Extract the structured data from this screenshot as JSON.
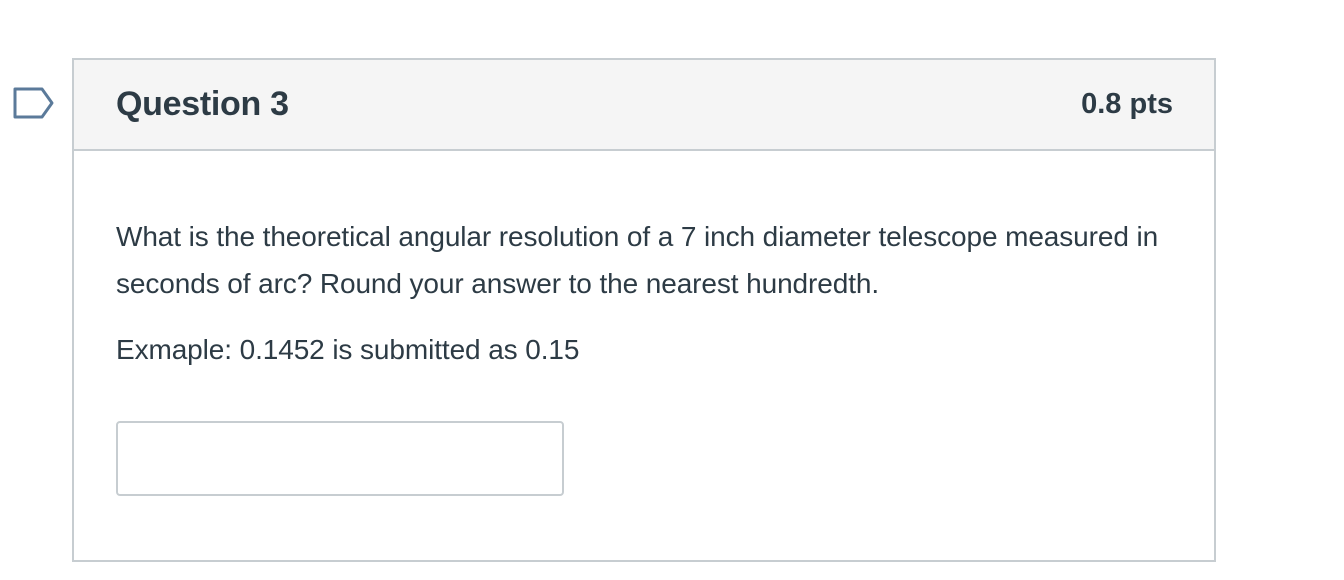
{
  "question": {
    "title": "Question 3",
    "points": "0.8 pts",
    "text": "What is the theoretical angular resolution of a 7 inch diameter telescope measured in seconds of arc? Round your answer to the nearest hundredth.",
    "example": "Exmaple: 0.1452 is submitted as 0.15",
    "answer_value": ""
  },
  "icons": {
    "flag": "flag-question-icon"
  },
  "colors": {
    "text": "#2d3b45",
    "border": "#c7cdd1",
    "header_bg": "#f5f5f5",
    "flag_border": "#5b7a9a"
  }
}
